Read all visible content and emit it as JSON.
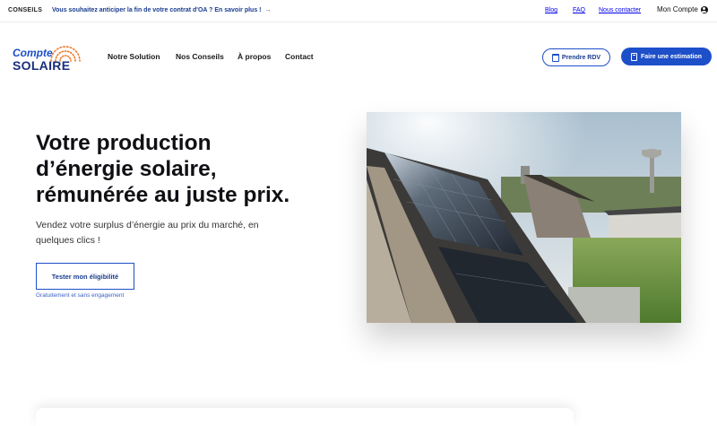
{
  "topbar": {
    "tag": "CONSEILS",
    "promo": "Vous souhaitez anticiper la fin de votre contrat d'OA ? En savoir plus !",
    "promo_arrow": "→",
    "links": {
      "blog": "Blog",
      "faq": "FAQ",
      "contact": "Nous contacter",
      "account": "Mon Compte"
    }
  },
  "logo": {
    "line1": "Compte",
    "line2": "SOLAIRE"
  },
  "nav": {
    "items": [
      "Notre Solution",
      "Nos Conseils",
      "À propos",
      "Contact"
    ]
  },
  "header_buttons": {
    "rdv": "Prendre RDV",
    "estimate": "Faire une estimation"
  },
  "hero": {
    "title_lines": [
      "Votre production",
      "d’énergie solaire,",
      "rémunérée au juste prix."
    ],
    "subtitle_lines": [
      "Vendez votre surplus d’énergie au prix du marché, en",
      "quelques clics !"
    ],
    "cta": "Tester mon éligibilité",
    "cta_note": "Gratuitement et sans engagement"
  },
  "colors": {
    "primary": "#1d4fc9",
    "navy": "#1a2f7a",
    "sun_orange": "#f07a2a"
  },
  "icons": {
    "account": "user-circle-icon",
    "rdv": "calendar-icon",
    "estimate": "calculator-icon",
    "promo": "arrow-right-icon"
  }
}
